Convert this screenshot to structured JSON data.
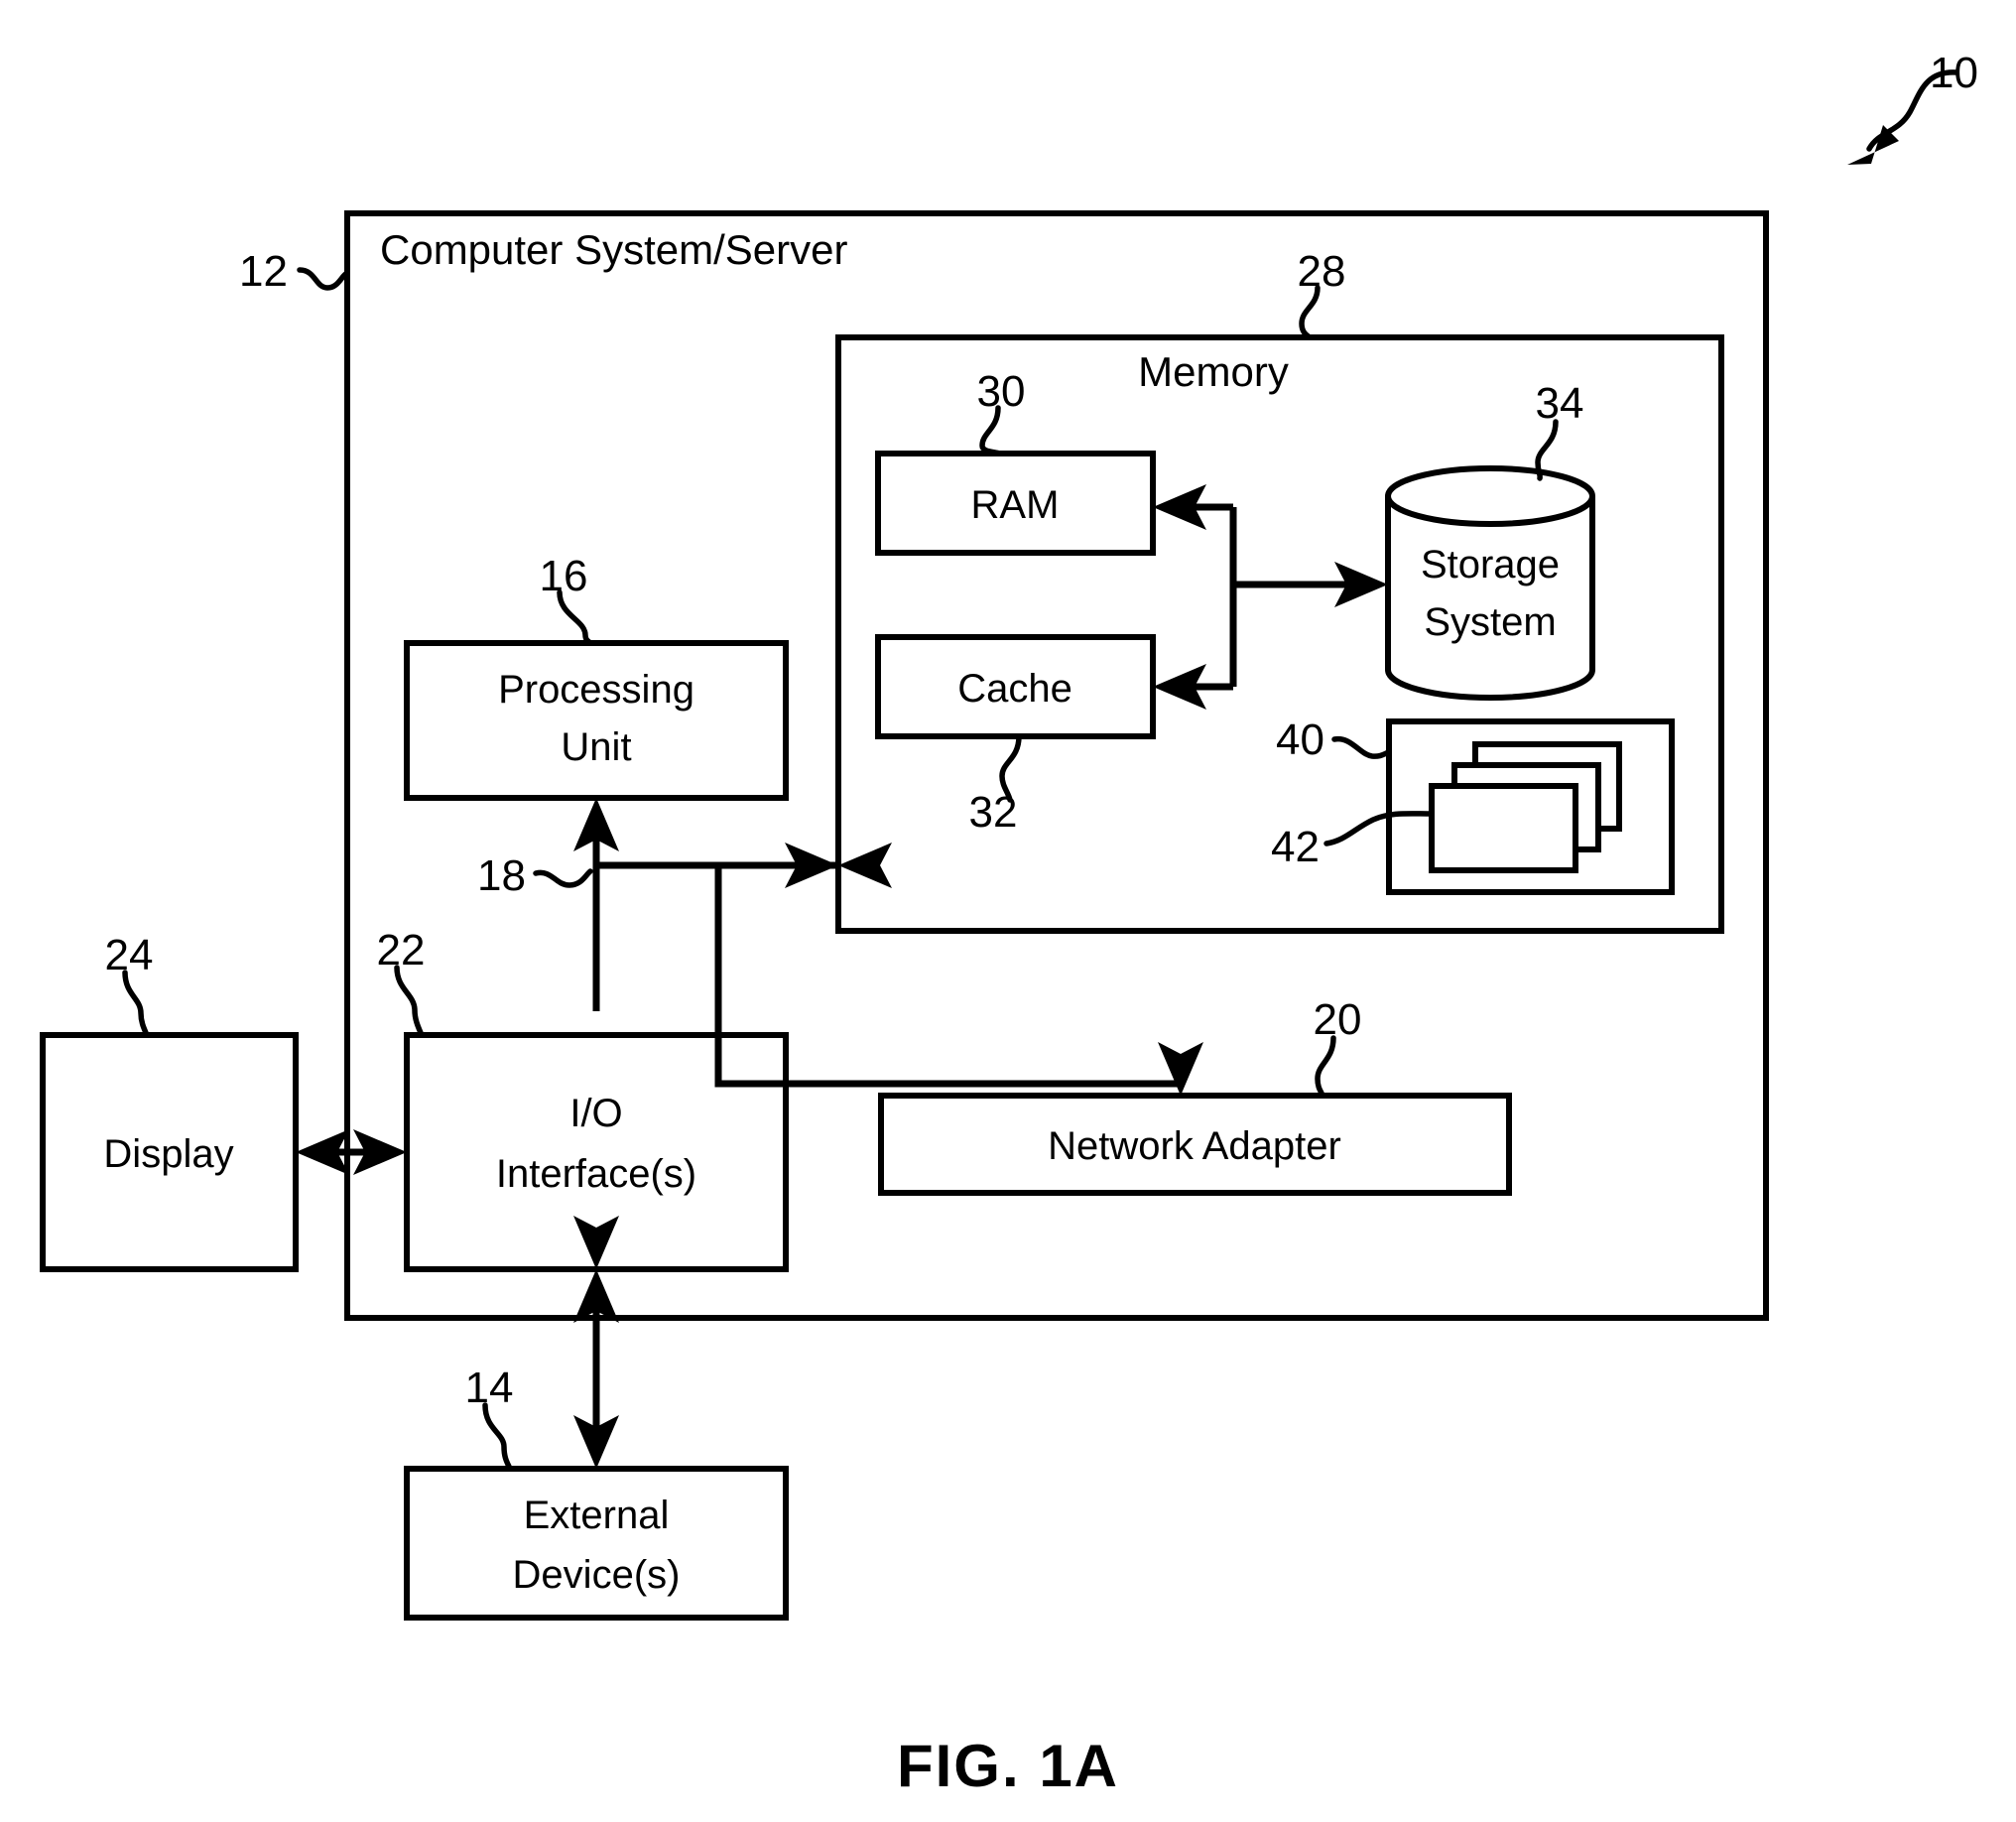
{
  "figure": {
    "caption": "FIG. 1A",
    "overall_ref": "10",
    "blocks": {
      "system": {
        "label": "Computer System/Server",
        "ref": "12"
      },
      "memory": {
        "label": "Memory",
        "ref": "28"
      },
      "ram": {
        "label": "RAM",
        "ref": "30"
      },
      "cache": {
        "label": "Cache",
        "ref": "32"
      },
      "storage": {
        "label_line1": "Storage",
        "label_line2": "System",
        "ref": "34"
      },
      "program": {
        "ref": "40"
      },
      "program_modules": {
        "ref": "42"
      },
      "processing_unit": {
        "label_line1": "Processing",
        "label_line2": "Unit",
        "ref": "16"
      },
      "bus": {
        "ref": "18"
      },
      "io_interface": {
        "label_line1": "I/O",
        "label_line2": "Interface(s)",
        "ref": "22"
      },
      "network_adapter": {
        "label": "Network Adapter",
        "ref": "20"
      },
      "display": {
        "label": "Display",
        "ref": "24"
      },
      "external_devices": {
        "label_line1": "External",
        "label_line2": "Device(s)",
        "ref": "14"
      }
    },
    "colors": {
      "ink": "#000000",
      "paper": "#ffffff"
    }
  }
}
